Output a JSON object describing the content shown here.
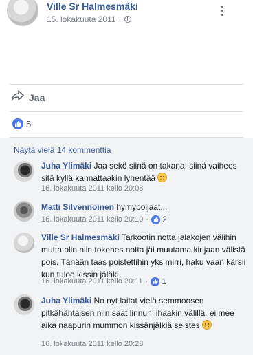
{
  "post": {
    "author": "Ville Sr Halmesmäki",
    "date": "15. lokakuuta 2011",
    "separator": "·",
    "share_label": "Jaa",
    "like_count": "5"
  },
  "comments_section": {
    "view_more": "Näytä vielä 14 kommenttia",
    "items": [
      {
        "author": "Juha Ylimäki",
        "text": "Jaa sekö siinä on takana, siinä vaihees sitä kyllä kannattaakin lyhentää",
        "timestamp": "16. lokakuuta 2011 kello 20:08",
        "likes": ""
      },
      {
        "author": "Matti Silvennoinen",
        "text": "hymypoijaat...",
        "timestamp": "16. lokakuuta 2011 kello 20:10",
        "likes": "2"
      },
      {
        "author": "Ville Sr Halmesmäki",
        "text": "Tarkootin notta jalakojen välihin mutta olin niin tokehes notta jäi muutama kirijaan välistä pois. Tänään taas poistettihin yks mirri, haku vaan kärsii kun tuloo kissin jäläki.",
        "timestamp": "16. lokakuuta 2011 kello 20:11",
        "likes": "1"
      },
      {
        "author": "Juha Ylimäki",
        "text": "No nyt laitat vielä semmoosen pitkähäntäisen niin saat linnun lihaakin välillä, ei mee aika naapurin mummon kissänjälkiä seistes",
        "timestamp": "16. lokakuuta 2011 kello 20:28",
        "likes": ""
      }
    ]
  },
  "icons": {
    "globe": "globe-icon",
    "more": "more-options-icon",
    "share": "share-arrow-icon",
    "like": "thumbs-up-icon",
    "smiley": "smiley-emoji-icon"
  },
  "colors": {
    "link": "#385898",
    "like_blue": "#4a76e8",
    "meta_gray": "#7a7f87"
  }
}
